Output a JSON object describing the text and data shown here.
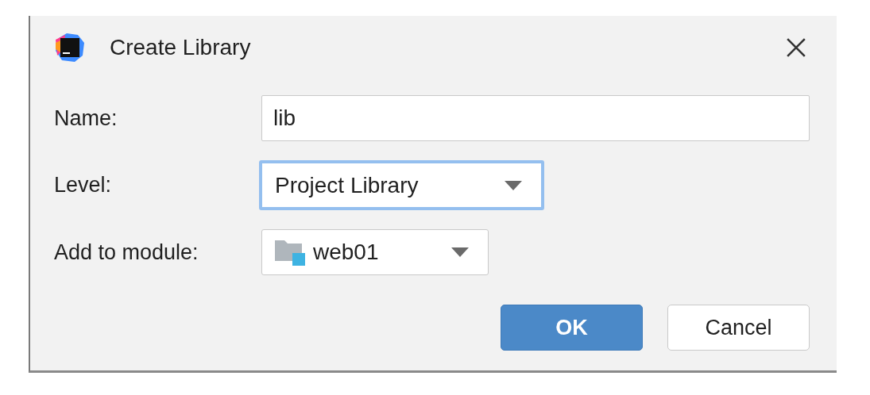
{
  "window": {
    "title": "Create Library"
  },
  "fields": [
    {
      "kind": "text",
      "label": "Name:",
      "value": "lib",
      "focused": false
    },
    {
      "kind": "dropdown",
      "label": "Level:",
      "value": "Project Library",
      "focused": true
    },
    {
      "kind": "module-dropdown",
      "label": "Add to module:",
      "value": "web01",
      "focused": false
    }
  ],
  "buttons": [
    {
      "label": "OK",
      "default": true
    },
    {
      "label": "Cancel",
      "default": false
    }
  ]
}
